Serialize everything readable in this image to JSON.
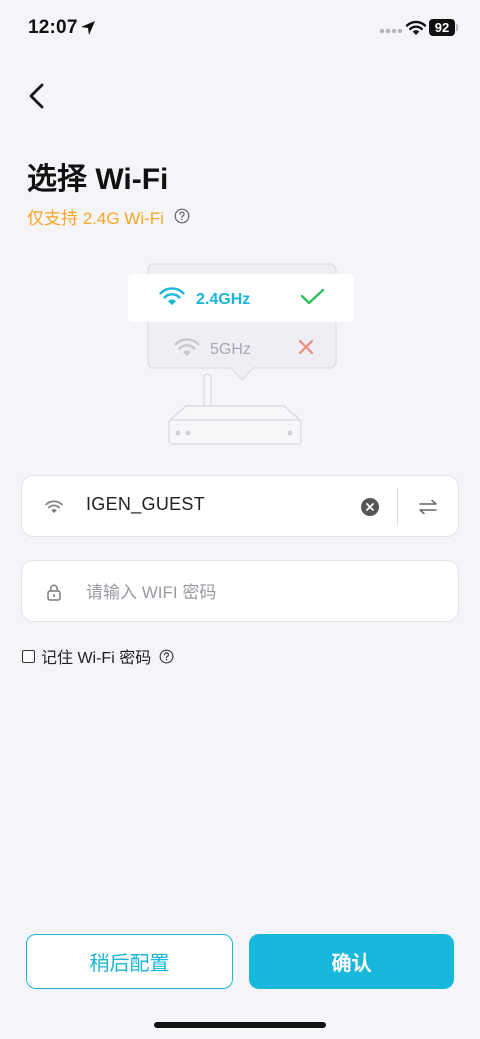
{
  "status_bar": {
    "time": "12:07",
    "battery": "92"
  },
  "header": {
    "title": "选择 Wi-Fi",
    "subtitle": "仅支持 2.4G Wi-Fi"
  },
  "illustration": {
    "band_24": "2.4GHz",
    "band_5": "5GHz"
  },
  "ssid_field": {
    "value": "IGEN_GUEST"
  },
  "password_field": {
    "placeholder": "请输入 WIFI 密码",
    "value": ""
  },
  "remember": {
    "label": "记住 Wi-Fi 密码",
    "checked": false
  },
  "buttons": {
    "later": "稍后配置",
    "confirm": "确认"
  },
  "colors": {
    "accent": "#18b7dc",
    "warning": "#f5a623",
    "success": "#2ec05a",
    "error": "#f08a7c"
  }
}
